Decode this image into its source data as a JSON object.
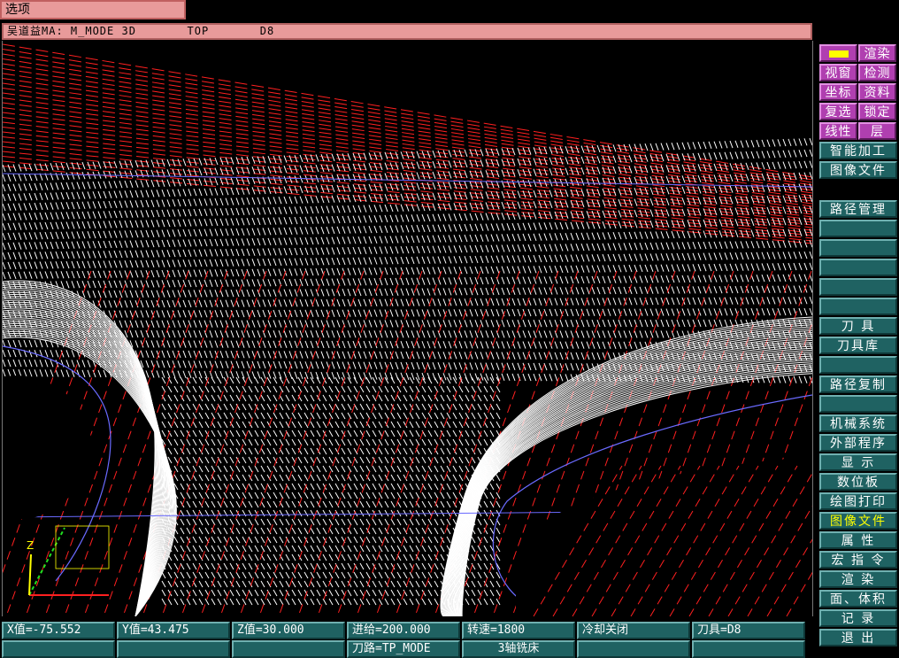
{
  "menu": {
    "options_label": "选项"
  },
  "status_line": "吴道益MA: M_MODE 3D       TOP       D8",
  "side_menu": {
    "color_label": "",
    "render": "渲染",
    "viewport": "视窗",
    "inspect": "检测",
    "coords": "坐标",
    "data": "资料",
    "reselect": "复选",
    "lock": "锁定",
    "linetype": "线性",
    "layer": "层",
    "smart_machining": "智能加工",
    "image_file_top": "图像文件",
    "path_manage": "路径管理",
    "tool": "刀 具",
    "tool_library": "刀具库",
    "path_copy": "路径复制",
    "machine_system": "机械系统",
    "external_program": "外部程序",
    "display": "显 示",
    "digitizer": "数位板",
    "plot_print": "绘图打印",
    "image_file": "图像文件",
    "properties": "属 性",
    "macro": "宏 指 令",
    "render2": "渲 染",
    "area_volume": "面、体积",
    "record": "记 录",
    "exit": "退 出"
  },
  "statusbar": {
    "x": "X值=-75.552",
    "y": "Y值=43.475",
    "z": "Z值=30.000",
    "feed": "进给=200.000",
    "speed": "转速=1800",
    "coolant": "冷却关闭",
    "tool": "刀具=D8",
    "toolpath": "刀路=TP_MODE",
    "machine": "3轴铣床"
  },
  "axis_label": "Z",
  "colors": {
    "title_bar": "#e89a9a",
    "button": "#1f6262",
    "button_pink": "#b03fb0",
    "highlight_text": "#ffff00",
    "toolpath_red": "#ff2020",
    "mesh_white": "#ffffff",
    "boundary_blue": "#6a6aff"
  }
}
